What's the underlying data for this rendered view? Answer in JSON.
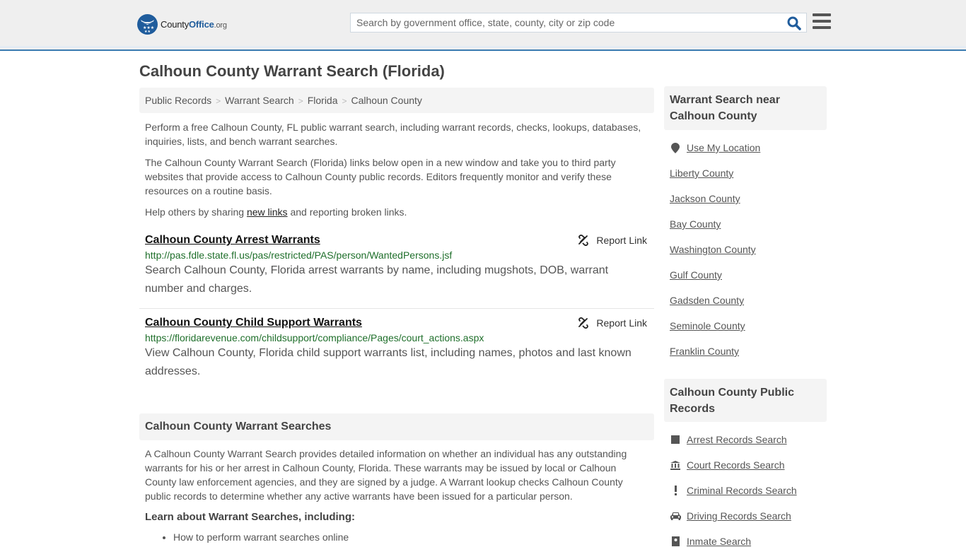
{
  "header": {
    "logo": {
      "name_part1": "County",
      "name_part2": "Office",
      "tld": ".org"
    },
    "search": {
      "placeholder": "Search by government office, state, county, city or zip code",
      "value": ""
    },
    "search_icon": "search-icon",
    "menu_icon": "hamburger-menu-icon",
    "accent_color": "#3a7bb0"
  },
  "page": {
    "title": "Calhoun County Warrant Search (Florida)",
    "breadcrumb": [
      "Public Records",
      "Warrant Search",
      "Florida",
      "Calhoun County"
    ],
    "intro": {
      "p1": "Perform a free Calhoun County, FL public warrant search, including warrant records, checks, lookups, databases, inquiries, lists, and bench warrant searches.",
      "p2": "The Calhoun County Warrant Search (Florida) links below open in a new window and take you to third party websites that provide access to Calhoun County public records. Editors frequently monitor and verify these resources on a routine basis.",
      "p3_prefix": "Help others by sharing ",
      "p3_link": "new links",
      "p3_suffix": " and reporting broken links."
    },
    "results": [
      {
        "title": "Calhoun County Arrest Warrants",
        "url": "http://pas.fdle.state.fl.us/pas/restricted/PAS/person/WantedPersons.jsf",
        "description": "Search Calhoun County, Florida arrest warrants by name, including mugshots, DOB, warrant number and charges.",
        "report_label": "Report Link"
      },
      {
        "title": "Calhoun County Child Support Warrants",
        "url": "https://floridarevenue.com/childsupport/compliance/Pages/court_actions.aspx",
        "description": "View Calhoun County, Florida child support warrants list, including names, photos and last known addresses.",
        "report_label": "Report Link"
      }
    ],
    "section": {
      "heading": "Calhoun County Warrant Searches",
      "body": "A Calhoun County Warrant Search provides detailed information on whether an individual has any outstanding warrants for his or her arrest in Calhoun County, Florida. These warrants may be issued by local or Calhoun County law enforcement agencies, and they are signed by a judge. A Warrant lookup checks Calhoun County public records to determine whether any active warrants have been issued for a particular person.",
      "learn_heading": "Learn about Warrant Searches, including:",
      "learn_items": [
        "How to perform warrant searches online"
      ]
    }
  },
  "sidebar": {
    "nearby": {
      "heading": "Warrant Search near Calhoun County",
      "use_location": "Use My Location",
      "counties": [
        "Liberty County",
        "Jackson County",
        "Bay County",
        "Washington County",
        "Gulf County",
        "Gadsden County",
        "Seminole County",
        "Franklin County"
      ]
    },
    "public_records": {
      "heading": "Calhoun County Public Records",
      "items": [
        {
          "label": "Arrest Records Search",
          "icon": "book-icon"
        },
        {
          "label": "Court Records Search",
          "icon": "courthouse-icon"
        },
        {
          "label": "Criminal Records Search",
          "icon": "exclamation-icon"
        },
        {
          "label": "Driving Records Search",
          "icon": "car-icon"
        },
        {
          "label": "Inmate Search",
          "icon": "id-badge-icon"
        }
      ]
    }
  }
}
